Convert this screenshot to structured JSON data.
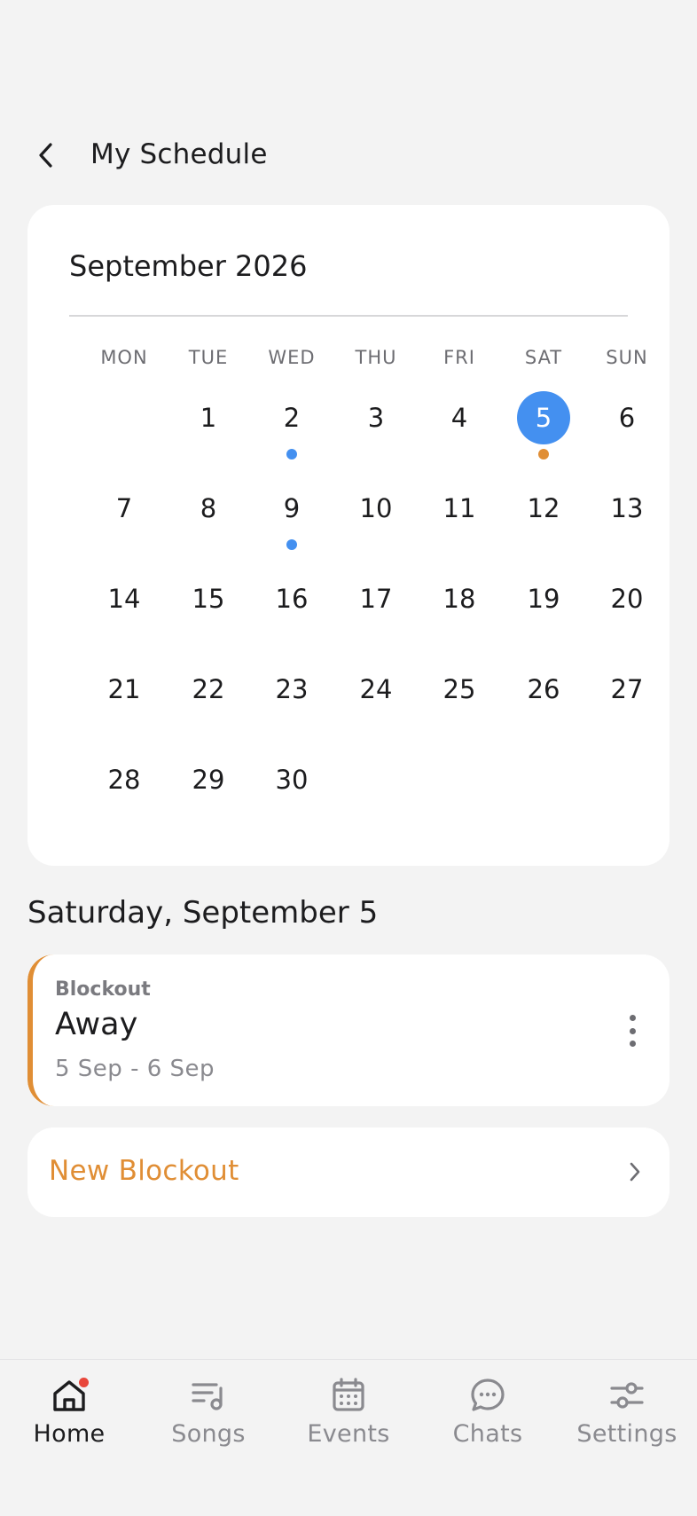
{
  "header": {
    "title": "My Schedule"
  },
  "calendar": {
    "month_label": "September 2026",
    "weekdays": [
      "MON",
      "TUE",
      "WED",
      "THU",
      "FRI",
      "SAT",
      "SUN"
    ],
    "first_weekday_index": 1,
    "days_in_month": 30,
    "selected_day": 5,
    "selected_color": "#4490f0",
    "markers": [
      {
        "day": 2,
        "color": "#4490f0"
      },
      {
        "day": 5,
        "color": "#e08e35"
      },
      {
        "day": 9,
        "color": "#4490f0"
      }
    ]
  },
  "selected_date_label": "Saturday, September 5",
  "event": {
    "type": "Blockout",
    "title": "Away",
    "dates": "5 Sep - 6 Sep",
    "accent_color": "#e08e35"
  },
  "new_blockout": {
    "label": "New Blockout"
  },
  "nav": {
    "items": [
      {
        "label": "Home",
        "icon": "home-icon",
        "active": true,
        "badge": true
      },
      {
        "label": "Songs",
        "icon": "songs-icon",
        "active": false,
        "badge": false
      },
      {
        "label": "Events",
        "icon": "calendar-icon",
        "active": false,
        "badge": false
      },
      {
        "label": "Chats",
        "icon": "chat-icon",
        "active": false,
        "badge": false
      },
      {
        "label": "Settings",
        "icon": "settings-icon",
        "active": false,
        "badge": false
      }
    ]
  }
}
